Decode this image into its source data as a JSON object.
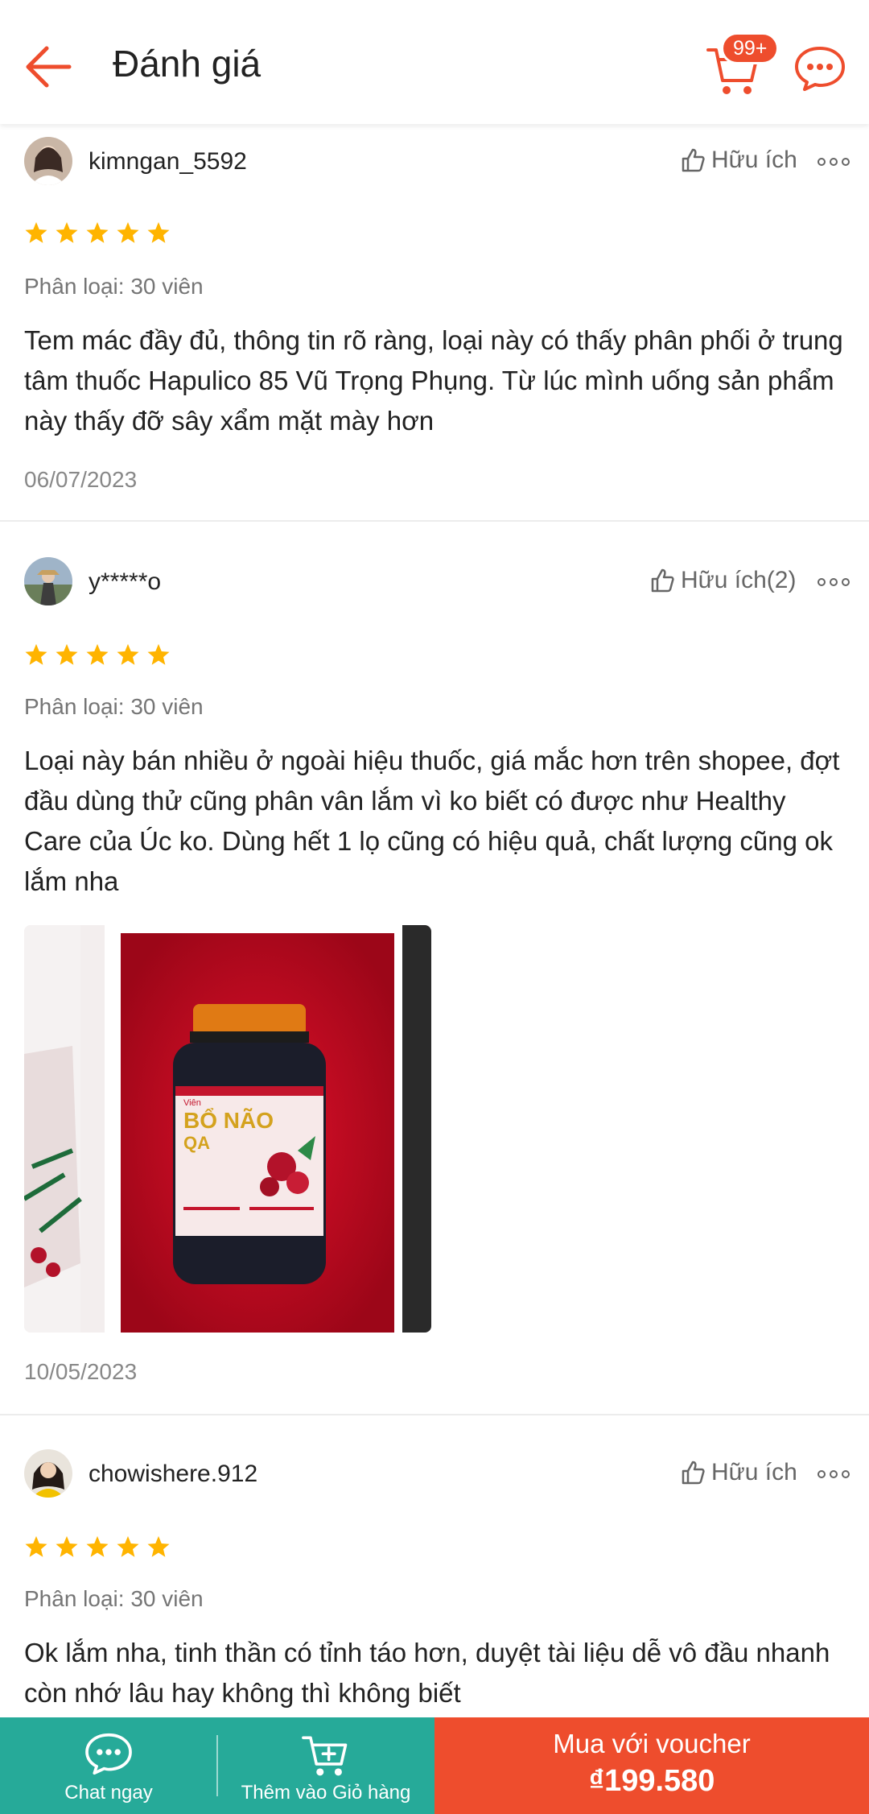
{
  "header": {
    "title": "Đánh giá",
    "cart_badge": "99+",
    "accent_color": "#ee4d2d"
  },
  "reviews": [
    {
      "username": "kimngan_5592",
      "helpful": "Hữu ích",
      "rating": 5,
      "variant": "Phân loại: 30 viên",
      "text": "Tem mác đầy đủ, thông tin rõ ràng, loại này có thấy phân phối ở trung tâm thuốc Hapulico 85 Vũ Trọng Phụng. Từ lúc mình uống sản phẩm này thấy đỡ sây xẩm mặt mày hơn",
      "date": "06/07/2023"
    },
    {
      "username": "y*****o",
      "helpful": "Hữu ích(2)",
      "rating": 5,
      "variant": "Phân loại: 30 viên",
      "text": "Loại này bán nhiều ở ngoài hiệu thuốc, giá mắc hơn trên shopee, đợt đầu dùng thử cũng phân vân lắm vì ko biết có được như Healthy Care của Úc ko. Dùng hết 1 lọ cũng có hiệu quả, chất lượng cũng ok lắm nha",
      "photo_label": {
        "brand": "Viên",
        "name1": "BỔ NÃO",
        "name2": "QA"
      },
      "date": "10/05/2023"
    },
    {
      "username": "chowishere.912",
      "helpful": "Hữu ích",
      "rating": 5,
      "variant": "Phân loại: 30 viên",
      "text": "Ok lắm nha, tinh thần có tỉnh táo hơn, duyệt tài liệu dễ vô đầu nhanh còn nhớ lâu hay không thì không biết"
    }
  ],
  "bottom_bar": {
    "chat_label": "Chat ngay",
    "cart_label": "Thêm vào Giỏ hàng",
    "buy_label": "Mua với voucher",
    "buy_price": "₫199.580",
    "chat_color": "#26aa99",
    "buy_color": "#ee4d2d"
  }
}
